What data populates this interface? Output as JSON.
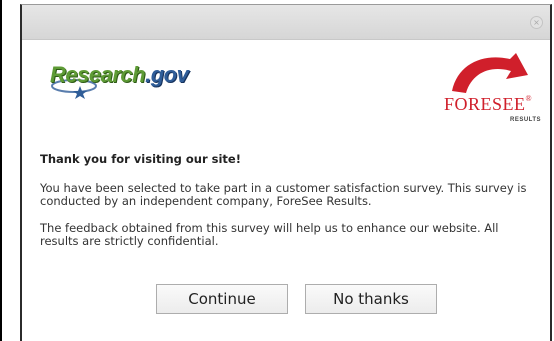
{
  "dialog": {
    "close_glyph": "×",
    "logos": {
      "research_main": "Research",
      "research_suffix": ".gov",
      "foresee_main": "FORESEE",
      "foresee_tm": "®",
      "foresee_sub": "RESULTS"
    },
    "heading": "Thank you for visiting our site!",
    "paragraph1": "You have been selected to take part in a customer satisfaction survey. This survey is conducted by an independent company, ForeSee Results.",
    "paragraph2": "The feedback obtained from this survey will help us to enhance our website. All results are strictly confidential.",
    "buttons": {
      "continue": "Continue",
      "no_thanks": "No thanks"
    }
  },
  "colors": {
    "research_green": "#5e9b35",
    "gov_blue": "#2f5d98",
    "foresee_red": "#d01f2b"
  }
}
